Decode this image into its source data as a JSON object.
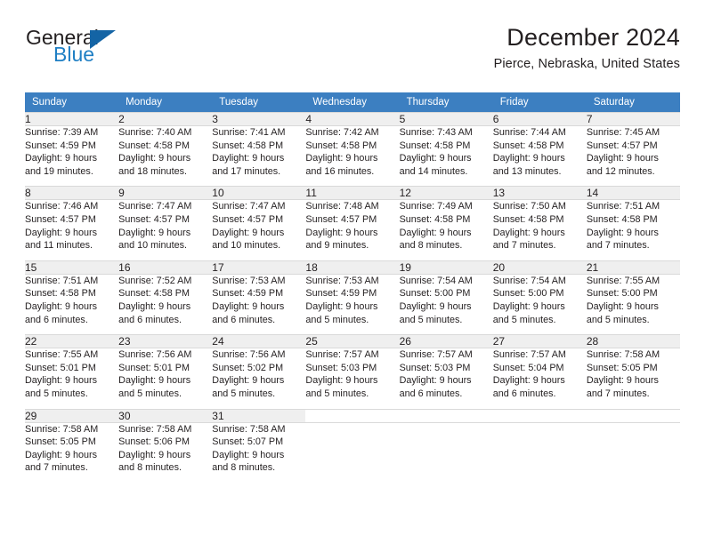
{
  "brand": {
    "name_dark": "General",
    "name_blue": "Blue",
    "accent_color": "#1464a5",
    "blue_text_color": "#1f7fc4"
  },
  "header": {
    "title": "December 2024",
    "subtitle": "Pierce, Nebraska, United States",
    "header_bg": "#3c7fc1",
    "daynum_bg": "#efefef"
  },
  "weekdays": [
    "Sunday",
    "Monday",
    "Tuesday",
    "Wednesday",
    "Thursday",
    "Friday",
    "Saturday"
  ],
  "labels": {
    "sunrise": "Sunrise:",
    "sunset": "Sunset:",
    "daylight": "Daylight:"
  },
  "weeks": [
    [
      {
        "day": "1",
        "sunrise": "Sunrise: 7:39 AM",
        "sunset": "Sunset: 4:59 PM",
        "daylight1": "Daylight: 9 hours",
        "daylight2": "and 19 minutes."
      },
      {
        "day": "2",
        "sunrise": "Sunrise: 7:40 AM",
        "sunset": "Sunset: 4:58 PM",
        "daylight1": "Daylight: 9 hours",
        "daylight2": "and 18 minutes."
      },
      {
        "day": "3",
        "sunrise": "Sunrise: 7:41 AM",
        "sunset": "Sunset: 4:58 PM",
        "daylight1": "Daylight: 9 hours",
        "daylight2": "and 17 minutes."
      },
      {
        "day": "4",
        "sunrise": "Sunrise: 7:42 AM",
        "sunset": "Sunset: 4:58 PM",
        "daylight1": "Daylight: 9 hours",
        "daylight2": "and 16 minutes."
      },
      {
        "day": "5",
        "sunrise": "Sunrise: 7:43 AM",
        "sunset": "Sunset: 4:58 PM",
        "daylight1": "Daylight: 9 hours",
        "daylight2": "and 14 minutes."
      },
      {
        "day": "6",
        "sunrise": "Sunrise: 7:44 AM",
        "sunset": "Sunset: 4:58 PM",
        "daylight1": "Daylight: 9 hours",
        "daylight2": "and 13 minutes."
      },
      {
        "day": "7",
        "sunrise": "Sunrise: 7:45 AM",
        "sunset": "Sunset: 4:57 PM",
        "daylight1": "Daylight: 9 hours",
        "daylight2": "and 12 minutes."
      }
    ],
    [
      {
        "day": "8",
        "sunrise": "Sunrise: 7:46 AM",
        "sunset": "Sunset: 4:57 PM",
        "daylight1": "Daylight: 9 hours",
        "daylight2": "and 11 minutes."
      },
      {
        "day": "9",
        "sunrise": "Sunrise: 7:47 AM",
        "sunset": "Sunset: 4:57 PM",
        "daylight1": "Daylight: 9 hours",
        "daylight2": "and 10 minutes."
      },
      {
        "day": "10",
        "sunrise": "Sunrise: 7:47 AM",
        "sunset": "Sunset: 4:57 PM",
        "daylight1": "Daylight: 9 hours",
        "daylight2": "and 10 minutes."
      },
      {
        "day": "11",
        "sunrise": "Sunrise: 7:48 AM",
        "sunset": "Sunset: 4:57 PM",
        "daylight1": "Daylight: 9 hours",
        "daylight2": "and 9 minutes."
      },
      {
        "day": "12",
        "sunrise": "Sunrise: 7:49 AM",
        "sunset": "Sunset: 4:58 PM",
        "daylight1": "Daylight: 9 hours",
        "daylight2": "and 8 minutes."
      },
      {
        "day": "13",
        "sunrise": "Sunrise: 7:50 AM",
        "sunset": "Sunset: 4:58 PM",
        "daylight1": "Daylight: 9 hours",
        "daylight2": "and 7 minutes."
      },
      {
        "day": "14",
        "sunrise": "Sunrise: 7:51 AM",
        "sunset": "Sunset: 4:58 PM",
        "daylight1": "Daylight: 9 hours",
        "daylight2": "and 7 minutes."
      }
    ],
    [
      {
        "day": "15",
        "sunrise": "Sunrise: 7:51 AM",
        "sunset": "Sunset: 4:58 PM",
        "daylight1": "Daylight: 9 hours",
        "daylight2": "and 6 minutes."
      },
      {
        "day": "16",
        "sunrise": "Sunrise: 7:52 AM",
        "sunset": "Sunset: 4:58 PM",
        "daylight1": "Daylight: 9 hours",
        "daylight2": "and 6 minutes."
      },
      {
        "day": "17",
        "sunrise": "Sunrise: 7:53 AM",
        "sunset": "Sunset: 4:59 PM",
        "daylight1": "Daylight: 9 hours",
        "daylight2": "and 6 minutes."
      },
      {
        "day": "18",
        "sunrise": "Sunrise: 7:53 AM",
        "sunset": "Sunset: 4:59 PM",
        "daylight1": "Daylight: 9 hours",
        "daylight2": "and 5 minutes."
      },
      {
        "day": "19",
        "sunrise": "Sunrise: 7:54 AM",
        "sunset": "Sunset: 5:00 PM",
        "daylight1": "Daylight: 9 hours",
        "daylight2": "and 5 minutes."
      },
      {
        "day": "20",
        "sunrise": "Sunrise: 7:54 AM",
        "sunset": "Sunset: 5:00 PM",
        "daylight1": "Daylight: 9 hours",
        "daylight2": "and 5 minutes."
      },
      {
        "day": "21",
        "sunrise": "Sunrise: 7:55 AM",
        "sunset": "Sunset: 5:00 PM",
        "daylight1": "Daylight: 9 hours",
        "daylight2": "and 5 minutes."
      }
    ],
    [
      {
        "day": "22",
        "sunrise": "Sunrise: 7:55 AM",
        "sunset": "Sunset: 5:01 PM",
        "daylight1": "Daylight: 9 hours",
        "daylight2": "and 5 minutes."
      },
      {
        "day": "23",
        "sunrise": "Sunrise: 7:56 AM",
        "sunset": "Sunset: 5:01 PM",
        "daylight1": "Daylight: 9 hours",
        "daylight2": "and 5 minutes."
      },
      {
        "day": "24",
        "sunrise": "Sunrise: 7:56 AM",
        "sunset": "Sunset: 5:02 PM",
        "daylight1": "Daylight: 9 hours",
        "daylight2": "and 5 minutes."
      },
      {
        "day": "25",
        "sunrise": "Sunrise: 7:57 AM",
        "sunset": "Sunset: 5:03 PM",
        "daylight1": "Daylight: 9 hours",
        "daylight2": "and 5 minutes."
      },
      {
        "day": "26",
        "sunrise": "Sunrise: 7:57 AM",
        "sunset": "Sunset: 5:03 PM",
        "daylight1": "Daylight: 9 hours",
        "daylight2": "and 6 minutes."
      },
      {
        "day": "27",
        "sunrise": "Sunrise: 7:57 AM",
        "sunset": "Sunset: 5:04 PM",
        "daylight1": "Daylight: 9 hours",
        "daylight2": "and 6 minutes."
      },
      {
        "day": "28",
        "sunrise": "Sunrise: 7:58 AM",
        "sunset": "Sunset: 5:05 PM",
        "daylight1": "Daylight: 9 hours",
        "daylight2": "and 7 minutes."
      }
    ],
    [
      {
        "day": "29",
        "sunrise": "Sunrise: 7:58 AM",
        "sunset": "Sunset: 5:05 PM",
        "daylight1": "Daylight: 9 hours",
        "daylight2": "and 7 minutes."
      },
      {
        "day": "30",
        "sunrise": "Sunrise: 7:58 AM",
        "sunset": "Sunset: 5:06 PM",
        "daylight1": "Daylight: 9 hours",
        "daylight2": "and 8 minutes."
      },
      {
        "day": "31",
        "sunrise": "Sunrise: 7:58 AM",
        "sunset": "Sunset: 5:07 PM",
        "daylight1": "Daylight: 9 hours",
        "daylight2": "and 8 minutes."
      },
      {
        "day": "",
        "sunrise": "",
        "sunset": "",
        "daylight1": "",
        "daylight2": ""
      },
      {
        "day": "",
        "sunrise": "",
        "sunset": "",
        "daylight1": "",
        "daylight2": ""
      },
      {
        "day": "",
        "sunrise": "",
        "sunset": "",
        "daylight1": "",
        "daylight2": ""
      },
      {
        "day": "",
        "sunrise": "",
        "sunset": "",
        "daylight1": "",
        "daylight2": ""
      }
    ]
  ]
}
